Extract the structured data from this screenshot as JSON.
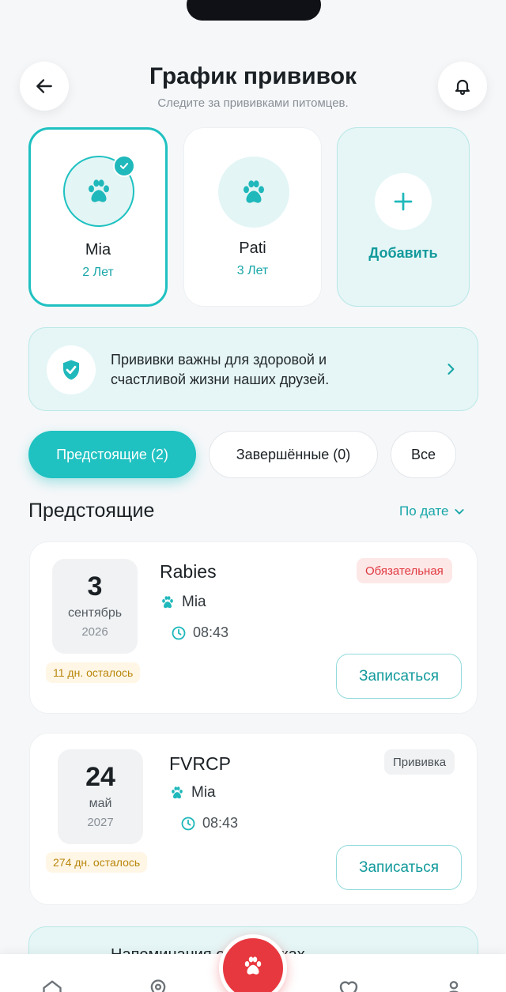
{
  "header": {
    "title": "График прививок",
    "subtitle": "Следите за прививками питомцев."
  },
  "pets": [
    {
      "name": "Mia",
      "age": "2 Лет",
      "selected": true
    },
    {
      "name": "Pati",
      "age": "3 Лет",
      "selected": false
    }
  ],
  "add_pet_label": "Добавить",
  "banner": {
    "line1": "Прививки важны для здоровой и",
    "line2": "счастливой жизни наших друзей."
  },
  "tabs": [
    {
      "label": "Предстоящие (2)",
      "active": true
    },
    {
      "label": "Завершённые (0)",
      "active": false
    },
    {
      "label": "Все",
      "active": false
    }
  ],
  "section": {
    "title": "Предстоящие",
    "sort_label": "По дате"
  },
  "vaccinations": [
    {
      "day": "3",
      "month": "сентябрь",
      "year": "2026",
      "days_left": "11 дн. осталось",
      "name": "Rabies",
      "pet": "Mia",
      "time": "08:43",
      "badge": "Обязательная",
      "badge_type": "required",
      "action": "Записаться"
    },
    {
      "day": "24",
      "month": "май",
      "year": "2027",
      "days_left": "274 дн. осталось",
      "name": "FVRCP",
      "pet": "Mia",
      "time": "08:43",
      "badge": "Прививка",
      "badge_type": "vaccine",
      "action": "Записаться"
    }
  ],
  "reminder": {
    "title": "Напоминания о прививках"
  },
  "navbar": {
    "items": [
      "home-icon",
      "map-pin-icon",
      "paw-icon",
      "heart-icon",
      "profile-icon"
    ]
  },
  "colors": {
    "accent": "#1fc1c1",
    "accent_text": "#19a6a8",
    "danger": "#e8383f",
    "background": "#f5f7f9"
  }
}
